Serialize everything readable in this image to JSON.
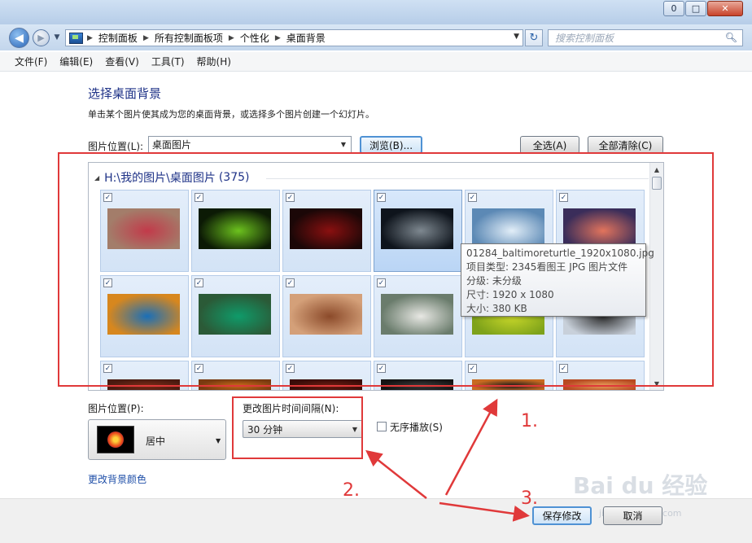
{
  "window": {
    "minimize": "0",
    "maximize": "□",
    "close": "✕"
  },
  "nav": {
    "breadcrumbs": [
      "控制面板",
      "所有控制面板项",
      "个性化",
      "桌面背景"
    ],
    "search_placeholder": "搜索控制面板"
  },
  "menu": [
    "文件(F)",
    "编辑(E)",
    "查看(V)",
    "工具(T)",
    "帮助(H)"
  ],
  "content": {
    "title": "选择桌面背景",
    "description": "单击某个图片使其成为您的桌面背景，或选择多个图片创建一个幻灯片。",
    "location_label": "图片位置(L):",
    "location_value": "桌面图片",
    "browse_label": "浏览(B)...",
    "select_all_label": "全选(A)",
    "clear_all_label": "全部清除(C)"
  },
  "gallery": {
    "group_path": "H:\\我的图片\\桌面图片",
    "group_count": "(375)",
    "check_glyph": "✓",
    "rows": [
      [
        {
          "theme": "woman-in-red-dress",
          "bg": "#a37d6a",
          "accent": "#c23a4a"
        },
        {
          "theme": "green-snake",
          "bg": "#0c1a05",
          "accent": "#6cc21e"
        },
        {
          "theme": "dark-red-abstract",
          "bg": "#1b0707",
          "accent": "#8a1010"
        },
        {
          "theme": "baltimore-turtle",
          "bg": "#0e141c",
          "accent": "#7e8890"
        },
        {
          "theme": "glacier",
          "bg": "#5c89b5",
          "accent": "#e2eef8"
        },
        {
          "theme": "sunset-lake",
          "bg": "#3a2d5a",
          "accent": "#e2745c"
        }
      ],
      [
        {
          "theme": "colorful-bird-orange",
          "bg": "#d7871e",
          "accent": "#1a6fb8"
        },
        {
          "theme": "green-bird",
          "bg": "#2b5a37",
          "accent": "#0f9b6a"
        },
        {
          "theme": "sparrow-on-branch",
          "bg": "#d4a079",
          "accent": "#8b4a2a"
        },
        {
          "theme": "white-tiger",
          "bg": "#6a7c6c",
          "accent": "#e8e8e4"
        },
        {
          "theme": "green-leaves",
          "bg": "#7ea21a",
          "accent": "#c9d82a"
        },
        {
          "theme": "bird-on-snow",
          "bg": "#c8d0da",
          "accent": "#2b2b2b"
        }
      ],
      [
        {
          "theme": "partial-row-1",
          "bg": "#4a1a10",
          "accent": "#7a2a16"
        },
        {
          "theme": "partial-row-2",
          "bg": "#7a3a10",
          "accent": "#c86a18"
        },
        {
          "theme": "partial-row-3",
          "bg": "#3a0c08",
          "accent": "#6a1a10"
        },
        {
          "theme": "partial-row-4",
          "bg": "#141414",
          "accent": "#3a3a3a"
        },
        {
          "theme": "partial-tiger",
          "bg": "#c86a20",
          "accent": "#1a1a1a"
        },
        {
          "theme": "partial-row-6",
          "bg": "#b84a22",
          "accent": "#e8a05a"
        }
      ]
    ]
  },
  "tooltip": {
    "lines": [
      "01284_baltimoreturtle_1920x1080.jpg",
      "项目类型: 2345看图王 JPG 图片文件",
      "分级: 未分级",
      "尺寸: 1920 x 1080",
      "大小: 380 KB"
    ]
  },
  "position": {
    "label": "图片位置(P):",
    "value": "居中"
  },
  "interval": {
    "label": "更改图片时间间隔(N):",
    "value": "30 分钟"
  },
  "shuffle_label": "无序播放(S)",
  "bgcolor_link": "更改背景颜色",
  "footer": {
    "save_label": "保存修改",
    "cancel_label": "取消"
  },
  "annotations": {
    "n1": "1.",
    "n2": "2.",
    "n3": "3.",
    "color": "#e0393a"
  },
  "watermark": {
    "text": "Bai du 经验",
    "sub": "jingyan.baidu.com"
  }
}
